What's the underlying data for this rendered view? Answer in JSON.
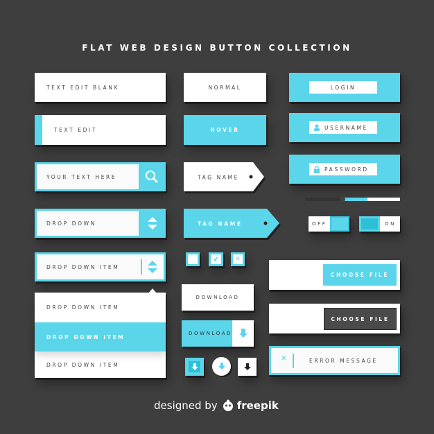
{
  "title": "FLAT WEB DESIGN BUTTON COLLECTION",
  "colors": {
    "accent": "#5ad5ea",
    "background": "#3e3e3e",
    "dark_button": "#4a4a4a"
  },
  "col1": {
    "text_edit_blank": "TEXT EDIT BLANK",
    "text_edit": "TEXT EDIT",
    "search_placeholder": "YOUR TEXT HERE",
    "search_icon": "search-icon",
    "drop_down": "DROP DOWN",
    "drop_down_item": "DROP DOWN ITEM",
    "list": [
      {
        "label": "DROP DOWN ITEM",
        "selected": false
      },
      {
        "label": "DROP DOWN ITEM",
        "selected": true
      },
      {
        "label": "DROP DOWN ITEM",
        "selected": false
      }
    ]
  },
  "col2": {
    "normal": "NORMAL",
    "hover": "HOVER",
    "tag1": "TAG NAME",
    "tag2": "TAG NAME",
    "checkboxes": [
      {
        "state": "empty"
      },
      {
        "state": "checked",
        "glyph": "✔"
      },
      {
        "state": "crossed",
        "glyph": "✕"
      }
    ],
    "download1": "DOWNLOAD",
    "download2": "DOWNLOAD",
    "icon_buttons": [
      "download-square-cyan",
      "download-circle",
      "download-square-white"
    ]
  },
  "col3": {
    "login": "LOGIN",
    "username": "USERNAME",
    "password": "PASSWORD",
    "slider_value_percent": 30,
    "toggle_off": "OFF",
    "toggle_on": "ON",
    "choose_file1": "CHOOSE FILE",
    "choose_file2": "CHOOSE FILE",
    "error_message": "ERROR MESSAGE",
    "error_icon": "✕"
  },
  "footer": {
    "designed_by": "designed by",
    "brand": "freepik"
  }
}
